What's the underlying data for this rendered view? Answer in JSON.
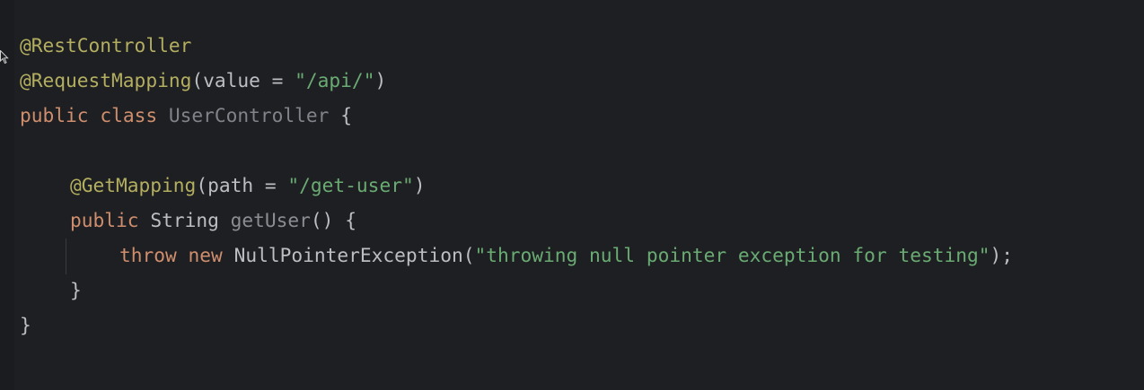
{
  "editor": {
    "colors": {
      "background": "#1e1f22",
      "annotation": "#b3ae60",
      "keyword": "#cf8e6d",
      "string": "#6aab73",
      "class_name": "#80838a",
      "method_name": "#8a8d93",
      "plain": "#bcbec4"
    },
    "icons": {
      "cursor": "mouse-pointer-icon"
    },
    "lines": [
      {
        "annotation": "@RestController"
      },
      {
        "annotation": "@RequestMapping",
        "open": "(value = ",
        "string": "\"/api/\"",
        "close": ")"
      },
      {
        "kw1": "public",
        "kw2": "class",
        "class_name": "UserController",
        "brace": "{"
      },
      {},
      {
        "annotation": "@GetMapping",
        "open": "(path = ",
        "string": "\"/get-user\"",
        "close": ")"
      },
      {
        "kw": "public",
        "type": "String",
        "method": "getUser",
        "rest": "() {"
      },
      {
        "kw1": "throw",
        "kw2": "new",
        "type": "NullPointerException",
        "open": "(",
        "string": "\"throwing null pointer exception for testing\"",
        "close": ");"
      },
      {
        "brace": "}"
      },
      {
        "brace": "}"
      }
    ]
  }
}
